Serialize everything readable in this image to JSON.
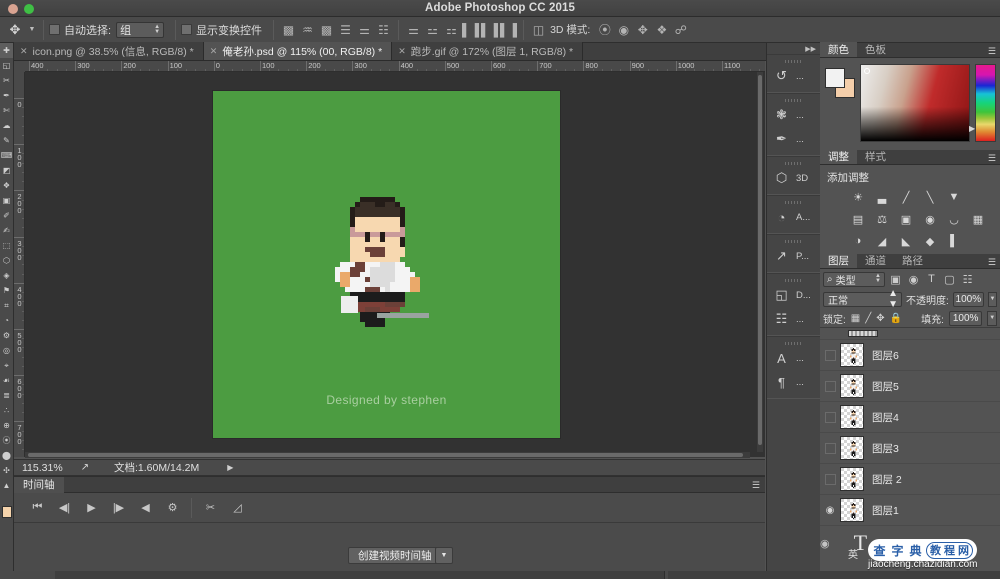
{
  "window": {
    "title": "Adobe Photoshop CC 2015",
    "close_dot": "close-dot",
    "zoom_dot": "zoom-dot"
  },
  "options_bar": {
    "tool_icon": "move-tool-icon",
    "auto_select_label": "自动选择:",
    "auto_select_value": "组",
    "show_transform_label": "显示变换控件",
    "align_icons": [
      "align-left-edges",
      "align-horizontal-centers",
      "align-right-edges",
      "align-top-edges",
      "align-vertical-centers",
      "align-bottom-edges"
    ],
    "distribute_icons": [
      "distribute-top-edges",
      "distribute-vertical-centers",
      "distribute-bottom-edges",
      "distribute-left-edges",
      "distribute-horizontal-centers",
      "distribute-right-edges"
    ],
    "extra_icon": "align-and-distribute-panel",
    "mode3d_label": "3D 模式:",
    "mode3d_icons": [
      "orbit-3d",
      "roll-3d",
      "pan-3d",
      "slide-3d",
      "scale-3d"
    ]
  },
  "document_tabs": [
    {
      "label": "icon.png @ 38.5% (信息, RGB/8) *",
      "active": false
    },
    {
      "label": "俺老孙.psd @ 115% (00, RGB/8) *",
      "active": true
    },
    {
      "label": "跑步.gif @ 172% (图层 1, RGB/8) *",
      "active": false
    }
  ],
  "rulers": {
    "horizontal": [
      "400",
      "300",
      "200",
      "100",
      "0",
      "100",
      "200",
      "300",
      "400",
      "500",
      "600",
      "700",
      "800",
      "900",
      "1000",
      "1100"
    ],
    "vertical": [
      "0",
      "100",
      "200",
      "300",
      "400",
      "500",
      "600",
      "700"
    ],
    "unit": "px"
  },
  "canvas": {
    "background_color": "#4c9c41",
    "caption": "Designed by stephen",
    "artwork_name": "pixel-art-running-man"
  },
  "status_bar": {
    "zoom": "115.31%",
    "share_icon": "share-icon",
    "doc_info": "文档:1.60M/14.2M",
    "arrow_icon": "chevron-right-icon"
  },
  "timeline": {
    "tab_label": "时间轴",
    "controls": [
      "go-to-first-frame",
      "previous-frame",
      "play",
      "next-frame",
      "audio-mute",
      "settings-gear",
      "split-clip",
      "transition"
    ],
    "create_button": "创建视频时间轴",
    "create_dropdown_icon": "chevron-down-icon"
  },
  "rail": {
    "groups": [
      {
        "items": [
          {
            "icon": "history-icon",
            "label": "..."
          }
        ]
      },
      {
        "items": [
          {
            "icon": "brushes-icon",
            "label": "..."
          },
          {
            "icon": "brush-presets-icon",
            "label": "..."
          }
        ]
      },
      {
        "items": [
          {
            "icon": "cube-3d-icon",
            "label": "3D"
          }
        ]
      },
      {
        "items": [
          {
            "icon": "actions-icon",
            "label": "A..."
          }
        ]
      },
      {
        "items": [
          {
            "icon": "properties-icon",
            "label": "P..."
          }
        ]
      },
      {
        "items": [
          {
            "icon": "device-preview-icon",
            "label": "D..."
          },
          {
            "icon": "measurement-log-icon",
            "label": "..."
          }
        ]
      },
      {
        "items": [
          {
            "icon": "character-icon",
            "label": "..."
          },
          {
            "icon": "paragraph-icon",
            "label": "..."
          }
        ]
      }
    ]
  },
  "color_panel": {
    "tabs": [
      {
        "label": "颜色",
        "active": true
      },
      {
        "label": "色板",
        "active": false
      }
    ],
    "foreground_color": "#f2f2f2",
    "background_color": "#f4ceaa",
    "menu_icon": "panel-menu-icon"
  },
  "adjustments_panel": {
    "tabs": [
      {
        "label": "调整",
        "active": true
      },
      {
        "label": "样式",
        "active": false
      }
    ],
    "title": "添加调整",
    "icons_row1": [
      "brightness-contrast",
      "levels",
      "curves",
      "exposure",
      "vibrance"
    ],
    "icons_row2": [
      "hue-saturation",
      "color-balance",
      "black-and-white",
      "photo-filter",
      "channel-mixer",
      "color-lookup"
    ],
    "icons_row3": [
      "invert",
      "posterize",
      "threshold",
      "gradient-map",
      "selective-color"
    ],
    "menu_icon": "panel-menu-icon"
  },
  "layers_panel": {
    "tabs": [
      {
        "label": "图层",
        "active": true
      },
      {
        "label": "通道",
        "active": false
      },
      {
        "label": "路径",
        "active": false
      }
    ],
    "filter_placeholder": "类型",
    "filter_icons": [
      "filter-pixel-icon",
      "filter-adjustment-icon",
      "filter-type-icon",
      "filter-shape-icon",
      "filter-smart-object-icon"
    ],
    "blend_mode": "正常",
    "opacity_label": "不透明度:",
    "opacity_value": "100%",
    "lock_label": "锁定:",
    "lock_icons": [
      "lock-transparent-pixels-icon",
      "lock-image-pixels-icon",
      "lock-position-icon",
      "lock-all-icon"
    ],
    "fill_label": "填充:",
    "fill_value": "100%",
    "layers": [
      {
        "name": "图层6",
        "visible": false
      },
      {
        "name": "图层5",
        "visible": false
      },
      {
        "name": "图层4",
        "visible": false
      },
      {
        "name": "图层3",
        "visible": false
      },
      {
        "name": "图层 2",
        "visible": false
      },
      {
        "name": "图层1",
        "visible": true
      }
    ],
    "text_layer": {
      "glyph": "T",
      "name": "英",
      "visible": true
    }
  },
  "watermark": {
    "char1": "查",
    "char2": "字",
    "char3": "典",
    "box_char1": "教",
    "box_char2": "程",
    "box_char3": "网",
    "url": "jiaocheng.chazidian.com"
  }
}
